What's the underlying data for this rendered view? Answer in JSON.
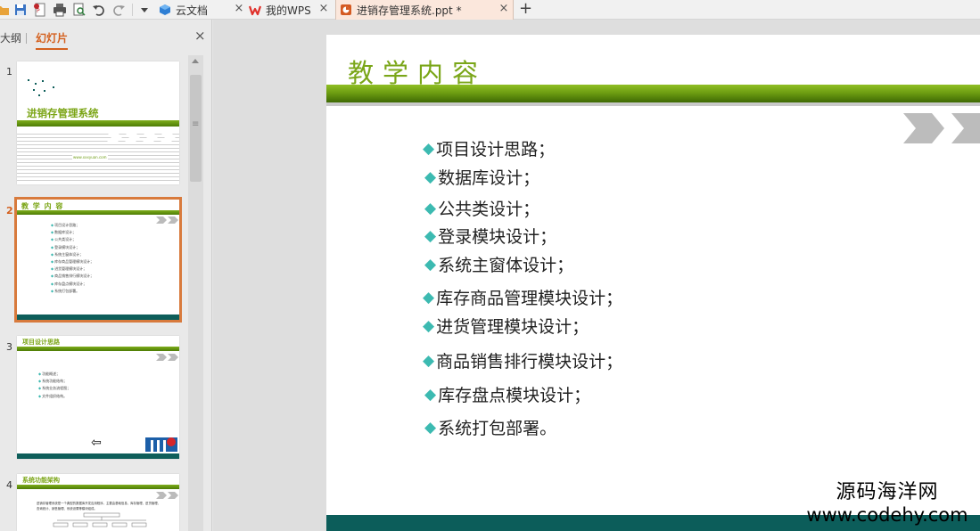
{
  "toolbar": {
    "quick_access": [
      "folder-icon",
      "save-icon",
      "pdf-export-icon",
      "print-icon",
      "print-preview-icon",
      "undo-icon",
      "redo-icon",
      "dropdown-icon"
    ]
  },
  "tabs": [
    {
      "label": "云文档",
      "icon": "cloud-doc-icon",
      "active": false
    },
    {
      "label": "我的WPS",
      "icon": "wps-logo-icon",
      "active": false
    },
    {
      "label": "进销存管理系统.ppt *",
      "icon": "ppt-file-icon",
      "active": true
    }
  ],
  "panel": {
    "tab_outline": "大纲",
    "tab_slides": "幻灯片",
    "thumbnails": [
      {
        "num": "1",
        "title": "进销存管理系统",
        "url": "www.xxxyuan.com"
      },
      {
        "num": "2",
        "title": "教 学 内 容",
        "items": [
          "项目设计思路；",
          "数据库设计；",
          "公共类设计；",
          "登录模块设计；",
          "系统主窗体设计；",
          "库存商品管理模块设计；",
          "进货管理模块设计；",
          "商品销售排行模块设计；",
          "库存盘点模块设计；",
          "系统打包部署。"
        ]
      },
      {
        "num": "3",
        "title": "项目设计思路",
        "items": [
          "功能概述；",
          "系统功能结构；",
          "系统业务流程图；",
          "文件组织结构。"
        ]
      },
      {
        "num": "4",
        "title": "系统功能架构",
        "text": "进销存管理系统是一个典型的数据库开发应用程序，主要由基础信息、库存管理、进货管理、查询统计、销售管理、系统设置等模块组成。"
      }
    ]
  },
  "slide": {
    "title": "教学内容",
    "bullets": [
      "项目设计思路；",
      "数据库设计；",
      "公共类设计；",
      "登录模块设计；",
      "系统主窗体设计；",
      "库存商品管理模块设计；",
      "进货管理模块设计；",
      "商品销售排行模块设计；",
      "库存盘点模块设计；",
      "系统打包部署。"
    ]
  },
  "watermark": {
    "line1": "源码海洋网",
    "line2": "www.codehy.com"
  },
  "colors": {
    "accent": "#d4601e",
    "title_green": "#7aa618",
    "bar_green": "#6e9e12",
    "footer_teal": "#0c5d5a",
    "bullet_teal": "#3cbab1"
  }
}
